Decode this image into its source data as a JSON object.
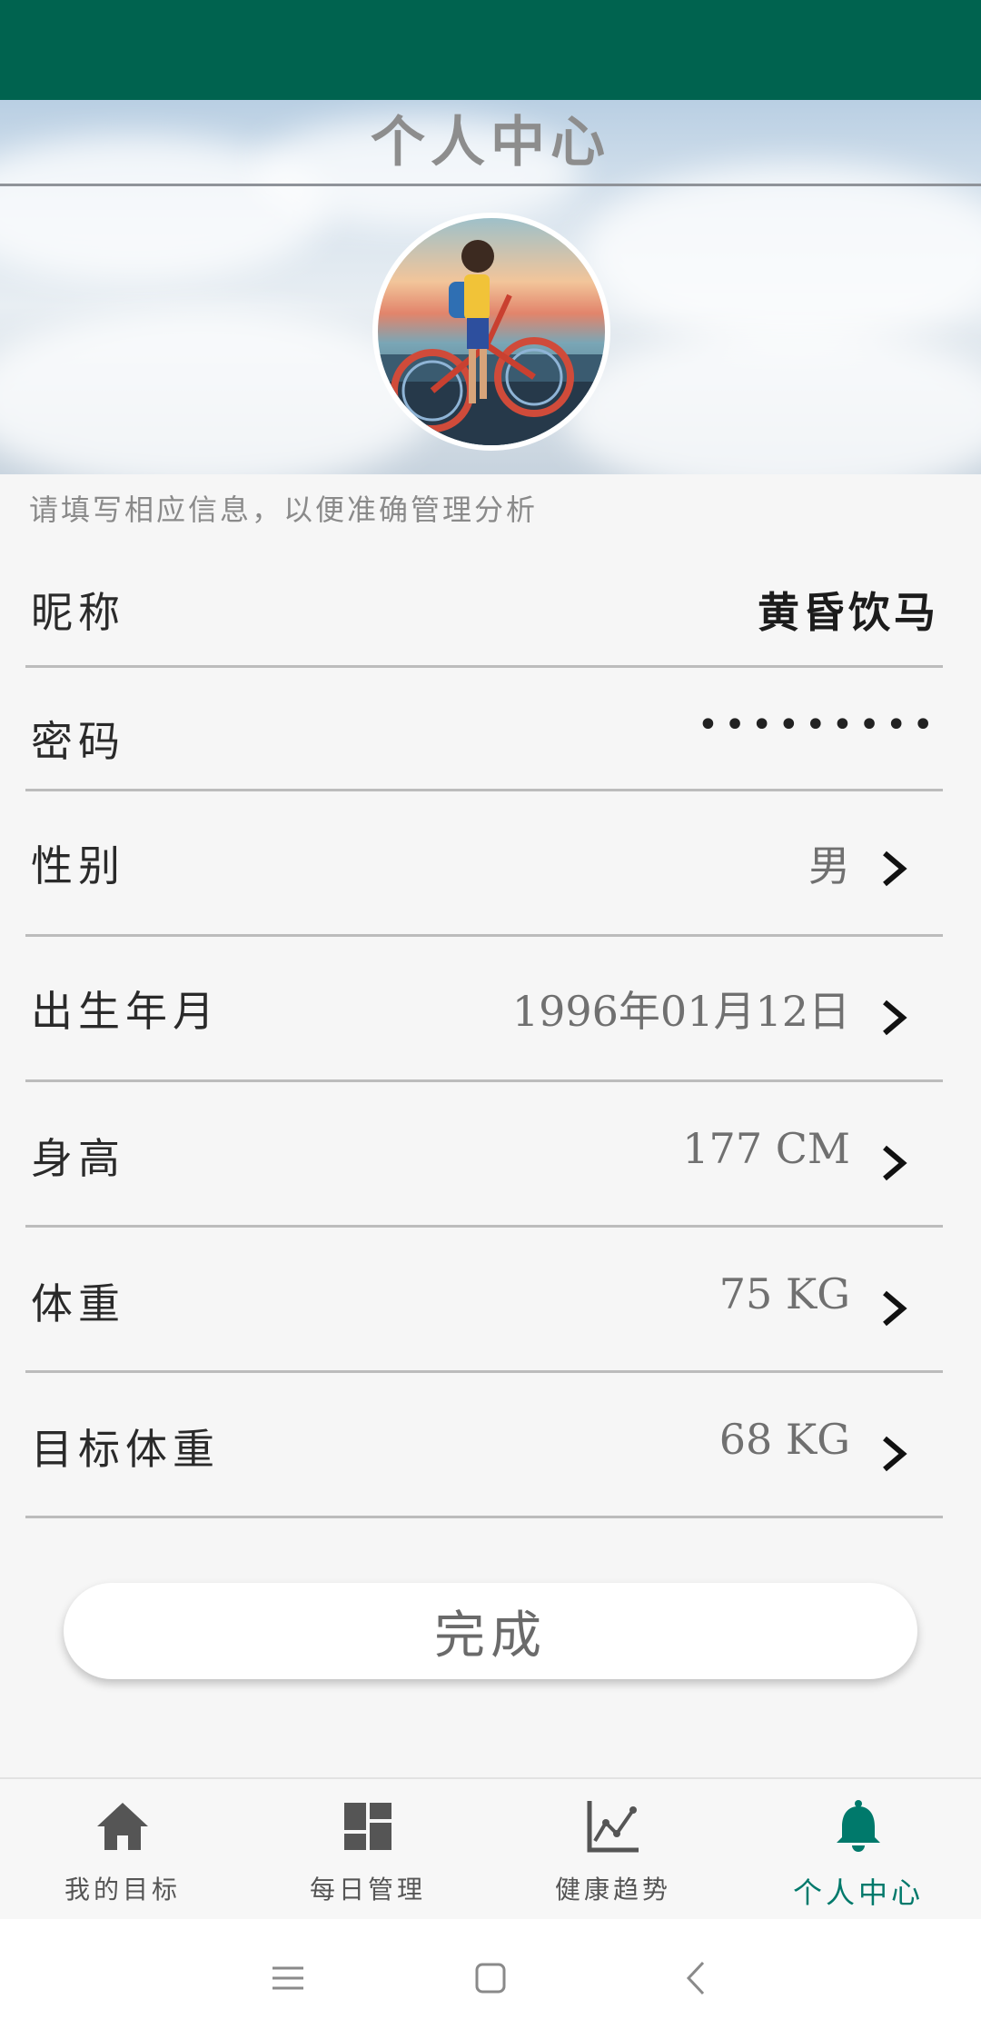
{
  "header": {
    "title": "个人中心"
  },
  "hint": "请填写相应信息，以便准确管理分析",
  "form": {
    "nickname": {
      "label": "昵称",
      "value": "黄昏饮马"
    },
    "password": {
      "label": "密码",
      "value": "•••••••••"
    },
    "gender": {
      "label": "性别",
      "value": "男"
    },
    "birth": {
      "label": "出生年月",
      "value": "1996年01月12日"
    },
    "height": {
      "label": "身高",
      "value": "177 CM"
    },
    "weight": {
      "label": "体重",
      "value": "75 KG"
    },
    "target_weight": {
      "label": "目标体重",
      "value": "68 KG"
    }
  },
  "finish_button": "完成",
  "nav": {
    "items": [
      {
        "label": "我的目标",
        "icon": "home-icon"
      },
      {
        "label": "每日管理",
        "icon": "dashboard-icon"
      },
      {
        "label": "健康趋势",
        "icon": "trend-chart-icon"
      },
      {
        "label": "个人中心",
        "icon": "bell-icon",
        "active": true
      }
    ]
  },
  "colors": {
    "status_bar": "#00634f",
    "accent": "#00796b"
  }
}
